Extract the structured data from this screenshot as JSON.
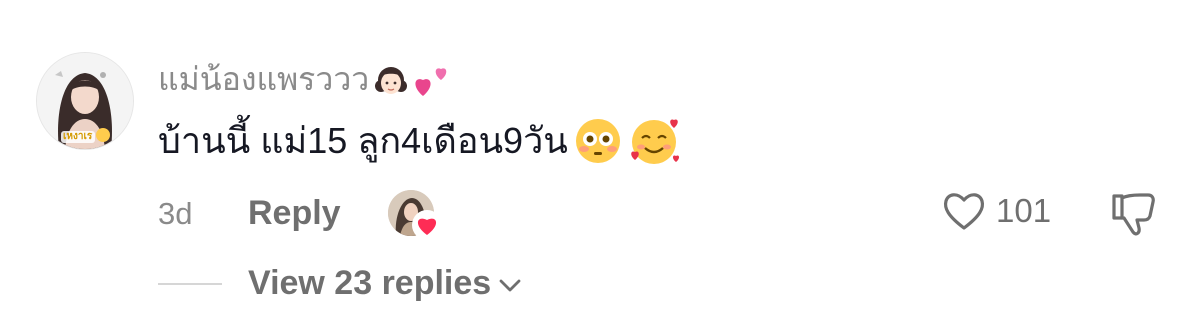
{
  "comment": {
    "username": "แม่น้องแพรววว",
    "username_emojis": [
      "girl-face-emoji",
      "two-hearts-emoji"
    ],
    "text": "บ้านนี้ แม่15 ลูก4เดือน9วัน",
    "text_emojis": [
      "flushed-face-emoji",
      "smiling-face-with-hearts-emoji"
    ],
    "timestamp": "3d",
    "avatar_caption": "เหงาเร",
    "reply_label": "Reply",
    "like_count": "101",
    "view_replies_label": "View 23 replies"
  },
  "icons": {
    "like": "heart-outline-icon",
    "dislike": "thumbs-down-outline-icon",
    "expand": "chevron-down-icon",
    "creator_like": "heart-filled-icon"
  },
  "colors": {
    "username": "#8a8a8a",
    "text": "#161823",
    "secondary": "#6f6f6f",
    "creator_heart": "#fe2c55"
  }
}
